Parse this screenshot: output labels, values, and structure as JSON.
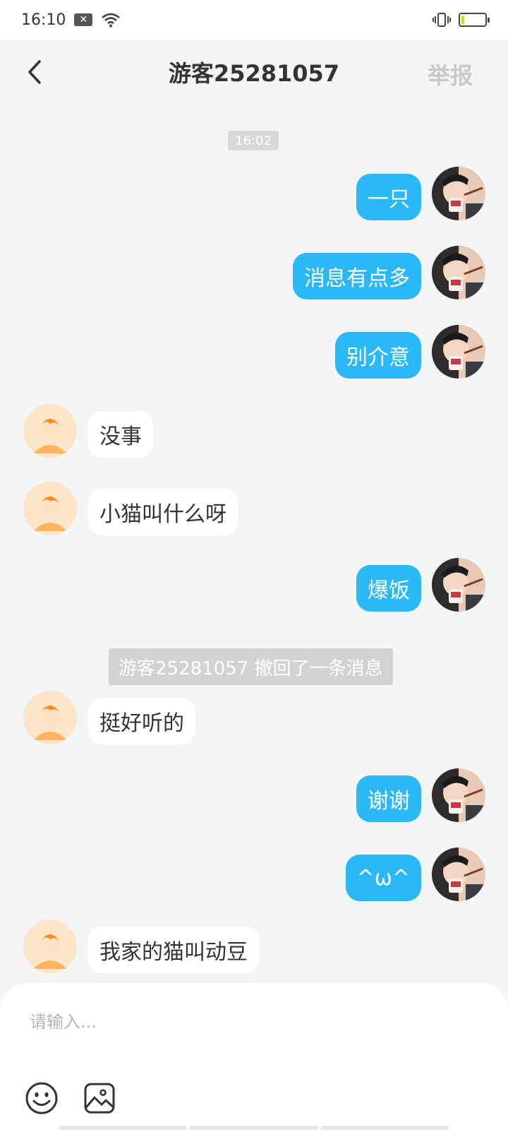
{
  "status_bar": {
    "time": "16:10",
    "notification_icon": "close-badge-icon",
    "wifi_icon": "wifi-icon",
    "vibrate_icon": "vibrate-icon",
    "battery_icon": "battery-icon",
    "battery_level": 0.12
  },
  "header": {
    "back_icon": "chevron-left-icon",
    "title": "游客25281057",
    "report_label": "举报"
  },
  "chat": {
    "time_label": "16:02",
    "messages": [
      {
        "side": "right",
        "text": "一只"
      },
      {
        "side": "right",
        "text": "消息有点多"
      },
      {
        "side": "right",
        "text": "别介意"
      },
      {
        "side": "left",
        "text": "没事"
      },
      {
        "side": "left",
        "text": "小猫叫什么呀"
      },
      {
        "side": "right",
        "text": "爆饭"
      },
      {
        "side": "left",
        "text": "挺好听的"
      },
      {
        "side": "right",
        "text": "谢谢"
      },
      {
        "side": "right",
        "text": "^ω^"
      },
      {
        "side": "left",
        "text": "我家的猫叫动豆"
      }
    ],
    "recall_notice": "游客25281057 撤回了一条消息"
  },
  "input": {
    "placeholder": "请输入...",
    "value": "",
    "emoji_icon": "smiley-icon",
    "image_icon": "image-icon"
  },
  "colors": {
    "accent": "#2bb8f6",
    "background": "#f4f5f7",
    "left_bubble": "#ffffff",
    "avatar_left_bg": "#fde6c8"
  }
}
